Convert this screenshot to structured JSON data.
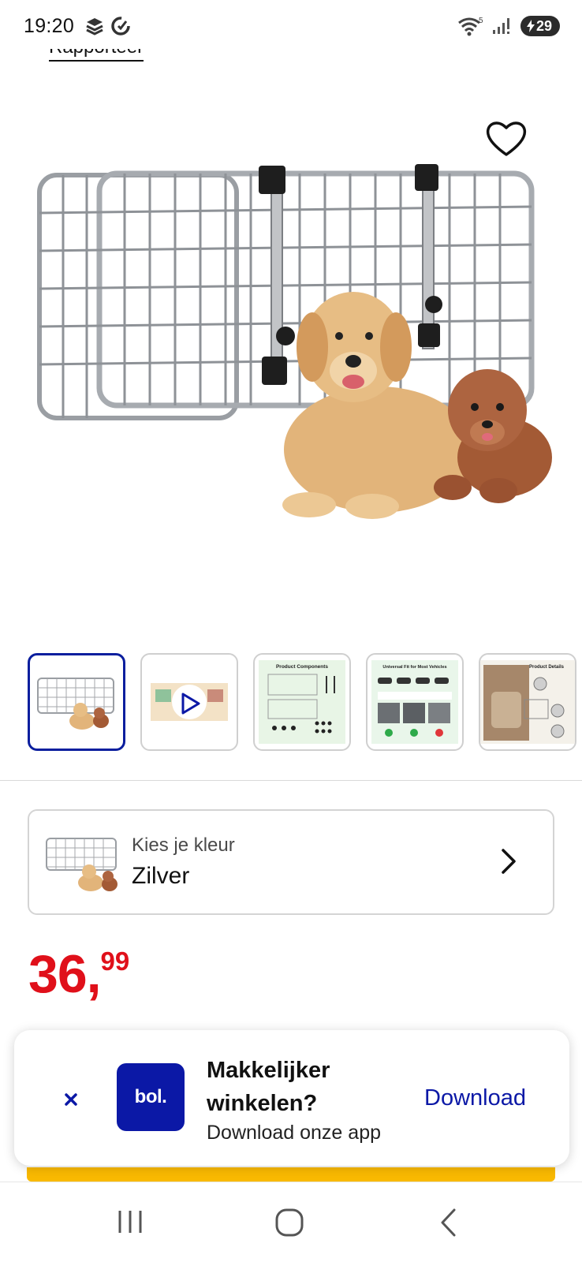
{
  "status_bar": {
    "time": "19:20",
    "network_label": "5",
    "battery": "29"
  },
  "top_link": {
    "label": "Rapporteer"
  },
  "product": {
    "image_description": "dog-car-barrier-image",
    "thumbnails": [
      {
        "name": "thumbnail-product-photo"
      },
      {
        "name": "thumbnail-video"
      },
      {
        "name": "thumbnail-components",
        "caption": "Product Components"
      },
      {
        "name": "thumbnail-vehicles",
        "caption": "Universal Fit for Most Vehicles"
      },
      {
        "name": "thumbnail-details",
        "caption": "Product Details"
      }
    ]
  },
  "color_selector": {
    "label": "Kies je kleur",
    "value": "Zilver"
  },
  "price": {
    "integer": "36,",
    "decimals": "99"
  },
  "app_banner": {
    "logo": "bol.",
    "title": "Makkelijker winkelen?",
    "subtitle": "Download onze app",
    "cta": "Download"
  },
  "colors": {
    "brand_blue": "#0b18a6",
    "price_red": "#e0101a",
    "cta_yellow": "#f9b900"
  }
}
